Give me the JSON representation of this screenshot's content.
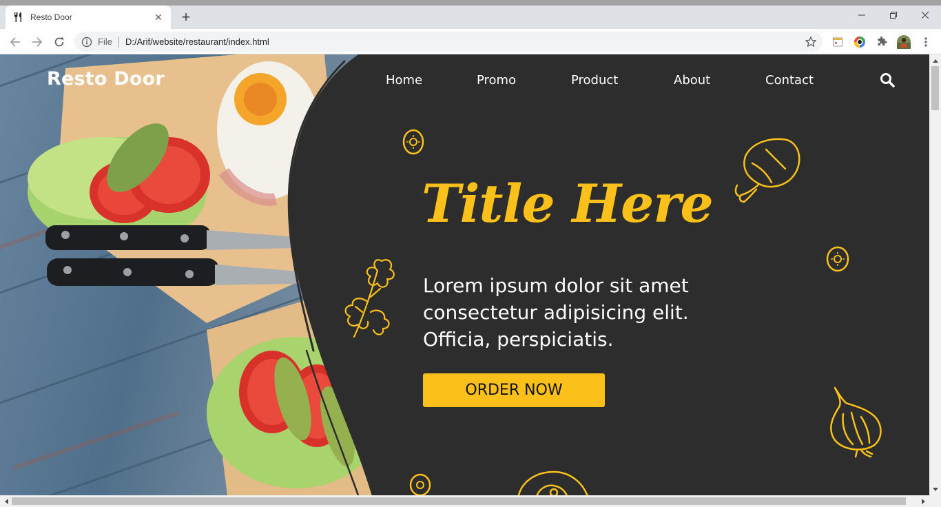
{
  "browser": {
    "tab_title": "Resto Door",
    "tab_close": "✕",
    "new_tab": "+",
    "url_scheme": "File",
    "url": "D:/Arif/website/restaurant/index.html"
  },
  "site": {
    "brand": "Resto Door",
    "nav": [
      "Home",
      "Promo",
      "Product",
      "About",
      "Contact"
    ],
    "hero_title": "Title Here",
    "hero_text": "Lorem ipsum dolor sit amet consectetur adipisicing elit. Officia, perspiciatis.",
    "cta_label": "ORDER NOW"
  },
  "colors": {
    "accent": "#fbc11a",
    "background": "#2d2d2d",
    "text": "#ffffff"
  },
  "icons": [
    "fork-knife-icon",
    "close-icon",
    "back-icon",
    "forward-icon",
    "reload-icon",
    "info-icon",
    "star-icon",
    "extension-icon",
    "search-icon",
    "menu-icon"
  ]
}
